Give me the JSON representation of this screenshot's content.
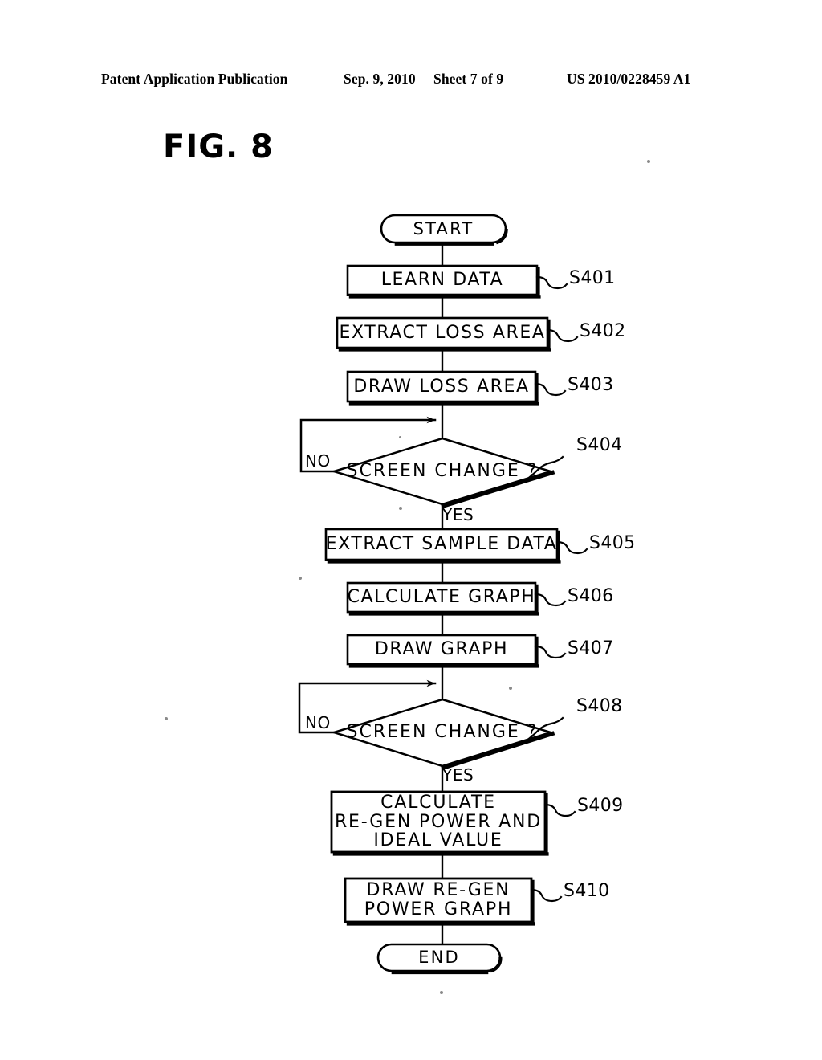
{
  "header": {
    "publication": "Patent Application Publication",
    "date": "Sep. 9, 2010",
    "sheet": "Sheet 7 of 9",
    "number": "US 2010/0228459 A1"
  },
  "figure": {
    "title": "FIG. 8",
    "type": "flowchart",
    "ink_color": "#000000",
    "background_color": "#ffffff"
  },
  "flowchart": {
    "nodes": [
      {
        "id": "start",
        "shape": "terminator",
        "text": "START",
        "step": null
      },
      {
        "id": "s401",
        "shape": "process",
        "text": "LEARN DATA",
        "step": "S401"
      },
      {
        "id": "s402",
        "shape": "process",
        "text": "EXTRACT LOSS AREA",
        "step": "S402"
      },
      {
        "id": "s403",
        "shape": "process",
        "text": "DRAW LOSS AREA",
        "step": "S403"
      },
      {
        "id": "s404",
        "shape": "decision",
        "text": "SCREEN CHANGE ?",
        "step": "S404"
      },
      {
        "id": "s405",
        "shape": "process",
        "text": "EXTRACT SAMPLE DATA",
        "step": "S405"
      },
      {
        "id": "s406",
        "shape": "process",
        "text": "CALCULATE GRAPH",
        "step": "S406"
      },
      {
        "id": "s407",
        "shape": "process",
        "text": "DRAW GRAPH",
        "step": "S407"
      },
      {
        "id": "s408",
        "shape": "decision",
        "text": "SCREEN CHANGE ?",
        "step": "S408"
      },
      {
        "id": "s409",
        "shape": "process",
        "text": "CALCULATE\nRE-GEN POWER AND\nIDEAL VALUE",
        "step": "S409"
      },
      {
        "id": "s410",
        "shape": "process",
        "text": "DRAW RE-GEN\nPOWER GRAPH",
        "step": "S410"
      },
      {
        "id": "end",
        "shape": "terminator",
        "text": "END",
        "step": null
      }
    ],
    "branch_labels": {
      "d1_no": "NO",
      "d1_yes": "YES",
      "d2_no": "NO",
      "d2_yes": "YES"
    }
  }
}
